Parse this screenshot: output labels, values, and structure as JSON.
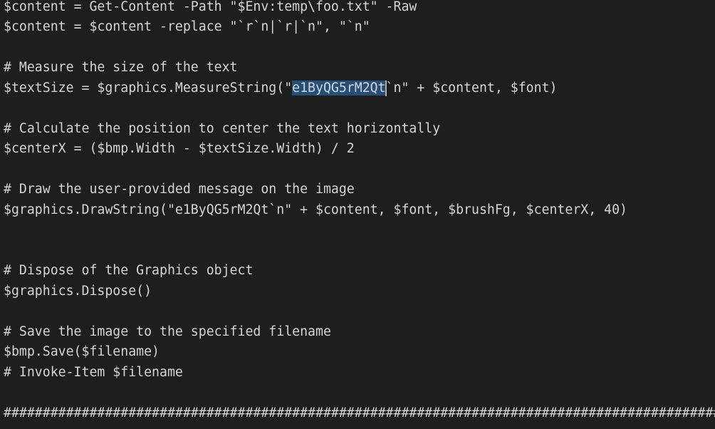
{
  "editor": {
    "lines": [
      "$content = Get-Content -Path \"$Env:temp\\foo.txt\" -Raw",
      "$content = $content -replace \"`r`n|`r|`n\", \"`n\"",
      "",
      "# Measure the size of the text",
      "$textSize = $graphics.MeasureString(\"e1ByQG5rM2Qt`n\" + $content, $font)",
      "",
      "# Calculate the position to center the text horizontally",
      "$centerX = ($bmp.Width - $textSize.Width) / 2",
      "",
      "# Draw the user-provided message on the image",
      "$graphics.DrawString(\"e1ByQG5rM2Qt`n\" + $content, $font, $brushFg, $centerX, 40)",
      "",
      "",
      "# Dispose of the Graphics object",
      "$graphics.Dispose()",
      "",
      "# Save the image to the specified filename",
      "$bmp.Save($filename)",
      "# Invoke-Item $filename",
      "",
      "##############################################################################################"
    ],
    "selection": {
      "before": "$textSize = $graphics.MeasureString(\"",
      "selected": "e1ByQG5rM2Qt",
      "after": "`n\" + $content, $font)"
    }
  },
  "colors": {
    "background": "#1e1e1e",
    "text": "#d4d4d4",
    "selection": "#264f78",
    "cursor": "#aeafad"
  }
}
